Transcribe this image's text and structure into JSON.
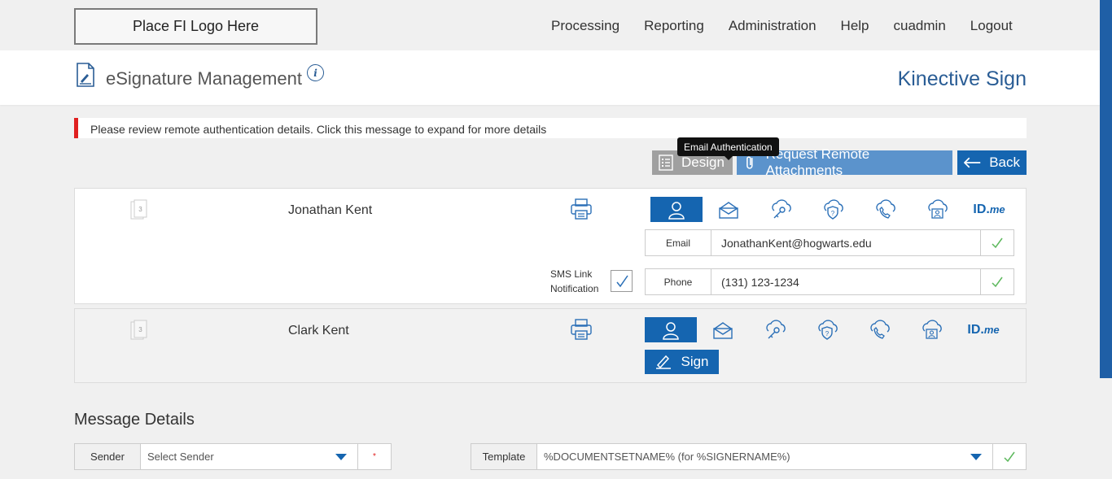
{
  "logo": {
    "text": "Place FI Logo Here"
  },
  "nav": [
    "Processing",
    "Reporting",
    "Administration",
    "Help",
    "cuadmin",
    "Logout"
  ],
  "header": {
    "title": "eSignature Management",
    "info": "i",
    "brand": "Kinective Sign"
  },
  "alert": {
    "text": "Please review remote authentication details. Click this message to expand for more details"
  },
  "tooltip": {
    "text": "Email Authentication"
  },
  "toolbar": {
    "design": "Design",
    "attachments": "Request Remote Attachments",
    "back": "Back"
  },
  "signers": [
    {
      "name": "Jonathan Kent",
      "stack_count": "3",
      "email_label": "Email",
      "email_value": "JonathanKent@hogwarts.edu",
      "phone_label": "Phone",
      "phone_value": "(131) 123-1234",
      "sms_label_1": "SMS Link",
      "sms_label_2": "Notification"
    },
    {
      "name": "Clark Kent",
      "stack_count": "3",
      "sign_label": "Sign"
    }
  ],
  "idme": {
    "id": "ID.",
    "me": "me"
  },
  "auth_icons": [
    "person-icon",
    "envelope-icon",
    "key-cloud-icon",
    "shield-cloud-icon",
    "phone-cloud-icon",
    "id-card-cloud-icon",
    "idme-logo"
  ],
  "message": {
    "title": "Message Details",
    "sender_label": "Sender",
    "sender_placeholder": "Select Sender",
    "sender_required": "*",
    "template_label": "Template",
    "template_value": "%DOCUMENTSETNAME% (for %SIGNERNAME%)"
  },
  "colors": {
    "primary": "#1565b0",
    "light_blue": "#5b93cc",
    "alert_red": "#e02020",
    "check_green": "#4caf50"
  }
}
